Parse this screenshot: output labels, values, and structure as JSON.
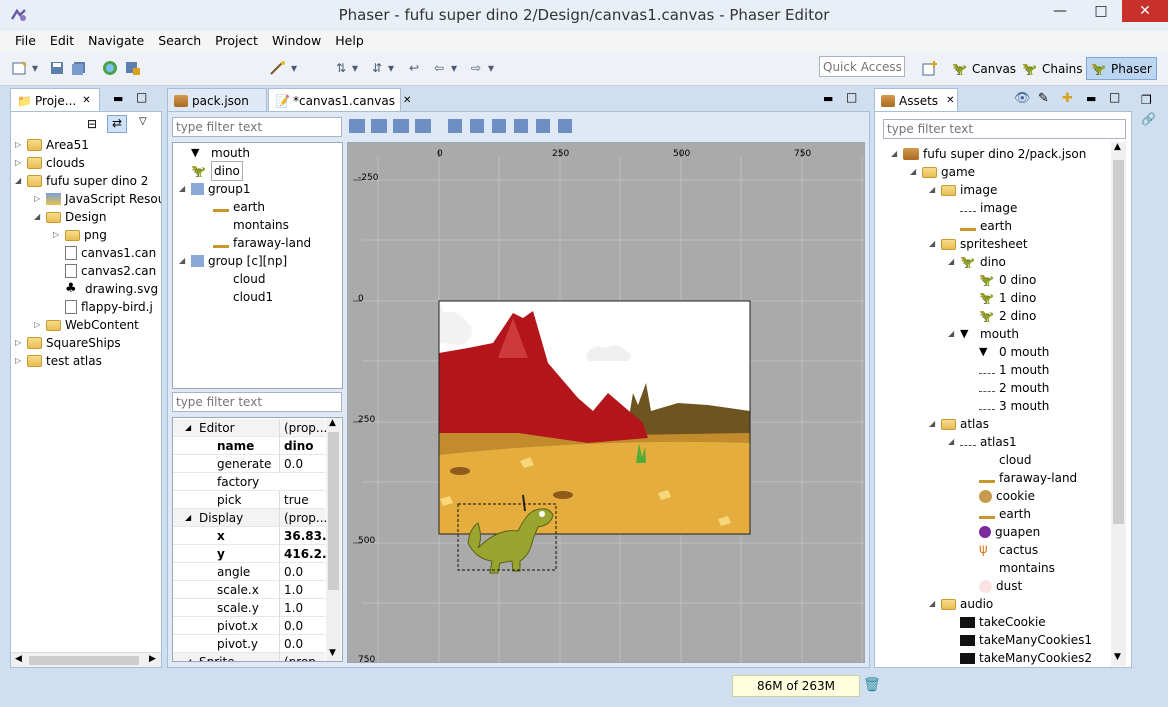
{
  "window": {
    "title": "Phaser - fufu super dino 2/Design/canvas1.canvas - Phaser Editor"
  },
  "menu": [
    "File",
    "Edit",
    "Navigate",
    "Search",
    "Project",
    "Window",
    "Help"
  ],
  "toolbar": {
    "quick_access": "Quick Access"
  },
  "perspectives": [
    {
      "label": "Canvas"
    },
    {
      "label": "Chains"
    },
    {
      "label": "Phaser"
    }
  ],
  "project_explorer": {
    "tab": "Proje...",
    "items": [
      {
        "label": "Area51",
        "depth": 0,
        "exp": "closed",
        "icon": "proj"
      },
      {
        "label": "clouds",
        "depth": 0,
        "exp": "closed",
        "icon": "proj"
      },
      {
        "label": "fufu super dino 2",
        "depth": 0,
        "exp": "open",
        "icon": "proj"
      },
      {
        "label": "JavaScript Resou",
        "depth": 1,
        "exp": "closed",
        "icon": "js"
      },
      {
        "label": "Design",
        "depth": 1,
        "exp": "open",
        "icon": "folder"
      },
      {
        "label": "png",
        "depth": 2,
        "exp": "closed",
        "icon": "folder"
      },
      {
        "label": "canvas1.can",
        "depth": 2,
        "exp": "none",
        "icon": "file"
      },
      {
        "label": "canvas2.can",
        "depth": 2,
        "exp": "none",
        "icon": "file"
      },
      {
        "label": "drawing.svg",
        "depth": 2,
        "exp": "none",
        "icon": "svg"
      },
      {
        "label": "flappy-bird.j",
        "depth": 2,
        "exp": "none",
        "icon": "file"
      },
      {
        "label": "WebContent",
        "depth": 1,
        "exp": "closed",
        "icon": "folder"
      },
      {
        "label": "SquareShips",
        "depth": 0,
        "exp": "closed",
        "icon": "proj"
      },
      {
        "label": "test atlas",
        "depth": 0,
        "exp": "closed",
        "icon": "proj"
      }
    ]
  },
  "editor_tabs": [
    {
      "label": "pack.json"
    },
    {
      "label": "*canvas1.canvas"
    }
  ],
  "outline": {
    "filter_placeholder": "type filter text",
    "items": [
      {
        "label": "mouth",
        "depth": 0,
        "exp": "none"
      },
      {
        "label": "dino",
        "depth": 0,
        "exp": "none"
      },
      {
        "label": "group1",
        "depth": 0,
        "exp": "open"
      },
      {
        "label": "earth",
        "depth": 1,
        "exp": "none"
      },
      {
        "label": "montains",
        "depth": 1,
        "exp": "none"
      },
      {
        "label": "faraway-land",
        "depth": 1,
        "exp": "none"
      },
      {
        "label": "group [c][np]",
        "depth": 0,
        "exp": "open"
      },
      {
        "label": "cloud",
        "depth": 1,
        "exp": "none"
      },
      {
        "label": "cloud1",
        "depth": 1,
        "exp": "none"
      }
    ]
  },
  "properties": {
    "filter_placeholder": "type filter text",
    "rows": [
      {
        "k": "Editor",
        "v": "(prop...",
        "cat": true
      },
      {
        "k": "name",
        "v": "dino",
        "bold": true
      },
      {
        "k": "generate",
        "v": "0.0"
      },
      {
        "k": "factory",
        "v": ""
      },
      {
        "k": "pick",
        "v": "true"
      },
      {
        "k": "Display",
        "v": "(prop...",
        "cat": true
      },
      {
        "k": "x",
        "v": "36.83...",
        "bold": true
      },
      {
        "k": "y",
        "v": "416.2...",
        "bold": true
      },
      {
        "k": "angle",
        "v": "0.0"
      },
      {
        "k": "scale.x",
        "v": "1.0"
      },
      {
        "k": "scale.y",
        "v": "1.0"
      },
      {
        "k": "pivot.x",
        "v": "0.0"
      },
      {
        "k": "pivot.y",
        "v": "0.0"
      },
      {
        "k": "Sprite",
        "v": "(prop...",
        "cat": true
      }
    ]
  },
  "canvas": {
    "ruler_x": [
      "0",
      "250",
      "500",
      "750"
    ],
    "ruler_y": [
      "-250",
      "0",
      "250",
      "500",
      "750"
    ]
  },
  "assets": {
    "tab": "Assets",
    "filter_placeholder": "type filter text",
    "items": [
      {
        "label": "fufu super dino 2/pack.json",
        "depth": 0,
        "exp": "open",
        "icon": "pack"
      },
      {
        "label": "game",
        "depth": 1,
        "exp": "open",
        "icon": "folder"
      },
      {
        "label": "image",
        "depth": 2,
        "exp": "open",
        "icon": "folder"
      },
      {
        "label": "image",
        "depth": 3,
        "exp": "none",
        "icon": "line"
      },
      {
        "label": "earth",
        "depth": 3,
        "exp": "none",
        "icon": "earth"
      },
      {
        "label": "spritesheet",
        "depth": 2,
        "exp": "open",
        "icon": "folder"
      },
      {
        "label": "dino",
        "depth": 3,
        "exp": "open",
        "icon": "dino"
      },
      {
        "label": "0 dino",
        "depth": 4,
        "exp": "none",
        "icon": "dino"
      },
      {
        "label": "1 dino",
        "depth": 4,
        "exp": "none",
        "icon": "dino"
      },
      {
        "label": "2 dino",
        "depth": 4,
        "exp": "none",
        "icon": "dino"
      },
      {
        "label": "mouth",
        "depth": 3,
        "exp": "open",
        "icon": "mouth"
      },
      {
        "label": "0 mouth",
        "depth": 4,
        "exp": "none",
        "icon": "mouth"
      },
      {
        "label": "1 mouth",
        "depth": 4,
        "exp": "none",
        "icon": "line"
      },
      {
        "label": "2 mouth",
        "depth": 4,
        "exp": "none",
        "icon": "line"
      },
      {
        "label": "3 mouth",
        "depth": 4,
        "exp": "none",
        "icon": "line"
      },
      {
        "label": "atlas",
        "depth": 2,
        "exp": "open",
        "icon": "folder"
      },
      {
        "label": "atlas1",
        "depth": 3,
        "exp": "open",
        "icon": "line"
      },
      {
        "label": "cloud",
        "depth": 4,
        "exp": "none",
        "icon": "blank"
      },
      {
        "label": "faraway-land",
        "depth": 4,
        "exp": "none",
        "icon": "earth"
      },
      {
        "label": "cookie",
        "depth": 4,
        "exp": "none",
        "icon": "cookie"
      },
      {
        "label": "earth",
        "depth": 4,
        "exp": "none",
        "icon": "earth"
      },
      {
        "label": "guapen",
        "depth": 4,
        "exp": "none",
        "icon": "guapen"
      },
      {
        "label": "cactus",
        "depth": 4,
        "exp": "none",
        "icon": "cactus"
      },
      {
        "label": "montains",
        "depth": 4,
        "exp": "none",
        "icon": "blank"
      },
      {
        "label": "dust",
        "depth": 4,
        "exp": "none",
        "icon": "dust"
      },
      {
        "label": "audio",
        "depth": 2,
        "exp": "open",
        "icon": "folder"
      },
      {
        "label": "takeCookie",
        "depth": 3,
        "exp": "none",
        "icon": "audio"
      },
      {
        "label": "takeManyCookies1",
        "depth": 3,
        "exp": "none",
        "icon": "audio"
      },
      {
        "label": "takeManyCookies2",
        "depth": 3,
        "exp": "none",
        "icon": "audio"
      }
    ]
  },
  "status": {
    "memory": "86M of 263M"
  }
}
